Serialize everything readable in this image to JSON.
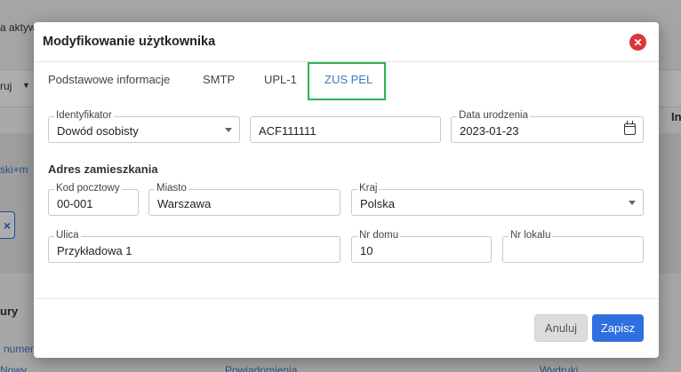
{
  "background": {
    "top_text": "a aktyw",
    "left_dropdown": "ruj",
    "link_text": "ski+m",
    "close_x": "×",
    "right_heading": "In",
    "bottom_heading": "ury",
    "bottom_link": "numer",
    "bottom_row_left": "Nowy",
    "bottom_row_mid": "Powiadomienia",
    "bottom_row_right": "Wydruki"
  },
  "modal": {
    "title": "Modyfikowanie użytkownika",
    "close_glyph": "✕",
    "tabs": [
      {
        "label": "Podstawowe informacje"
      },
      {
        "label": "SMTP"
      },
      {
        "label": "UPL-1"
      },
      {
        "label": "ZUS PEL"
      }
    ],
    "active_tab": "ZUS PEL",
    "identyfikator": {
      "label": "Identyfikator",
      "value": "Dowód osobisty"
    },
    "document_number": {
      "value": "ACF111111"
    },
    "birth_date": {
      "label": "Data urodzenia",
      "value": "2023-01-23"
    },
    "address_title": "Adres zamieszkania",
    "postal_code": {
      "label": "Kod pocztowy",
      "value": "00-001"
    },
    "city": {
      "label": "Miasto",
      "value": "Warszawa"
    },
    "country": {
      "label": "Kraj",
      "value": "Polska"
    },
    "street": {
      "label": "Ulica",
      "value": "Przykładowa 1"
    },
    "house_number": {
      "label": "Nr domu",
      "value": "10"
    },
    "apartment_number": {
      "label": "Nr lokalu",
      "value": ""
    },
    "buttons": {
      "cancel": "Anuluj",
      "save": "Zapisz"
    }
  },
  "colors": {
    "accent": "#2f6fe0",
    "tab_active": "#3b78c4",
    "highlight_border": "#2db34a",
    "close_button": "#d9363e"
  }
}
